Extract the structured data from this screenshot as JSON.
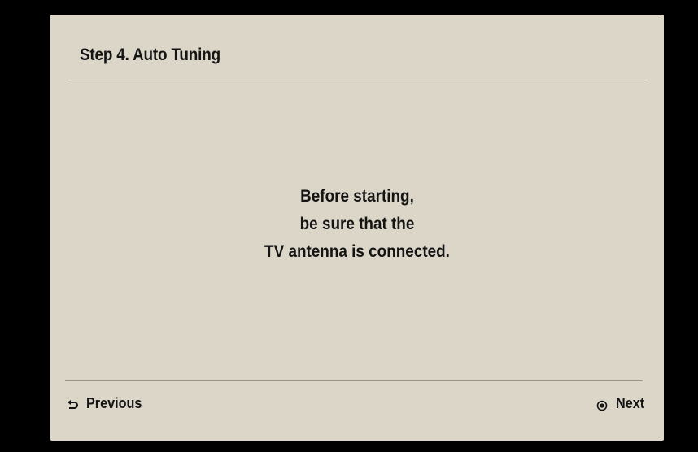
{
  "dialog": {
    "title": "Step 4. Auto Tuning",
    "message_lines": [
      "Before starting,",
      "be sure that the",
      "TV antenna is connected."
    ]
  },
  "footer": {
    "previous_label": "Previous",
    "previous_icon": "return-arrow-icon",
    "next_label": "Next",
    "next_icon": "ok-button-icon"
  },
  "colors": {
    "background": "#000000",
    "panel": "#dbd6c8",
    "text": "#141414",
    "divider": "#9b988f"
  }
}
